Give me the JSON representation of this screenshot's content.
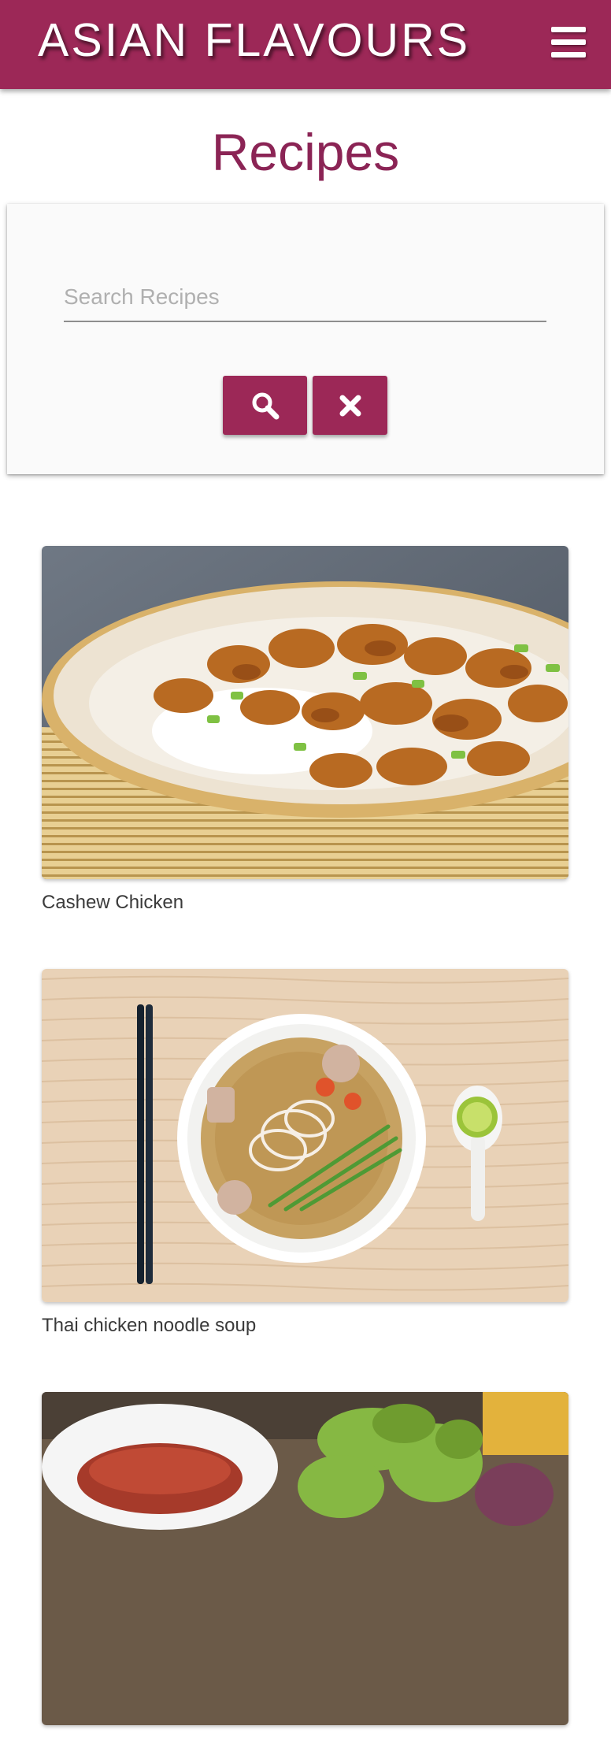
{
  "header": {
    "brand": "ASIAN FLAVOURS",
    "menu_icon": "hamburger-menu-icon",
    "background_color": "#9c2857"
  },
  "page": {
    "title": "Recipes"
  },
  "search": {
    "placeholder": "Search Recipes",
    "value": "",
    "search_icon": "search-icon",
    "clear_icon": "close-icon"
  },
  "recipes": [
    {
      "name": "Cashew Chicken"
    },
    {
      "name": "Thai chicken noodle soup"
    },
    {
      "name": ""
    }
  ],
  "colors": {
    "accent": "#9c2857",
    "title": "#8b2455"
  }
}
